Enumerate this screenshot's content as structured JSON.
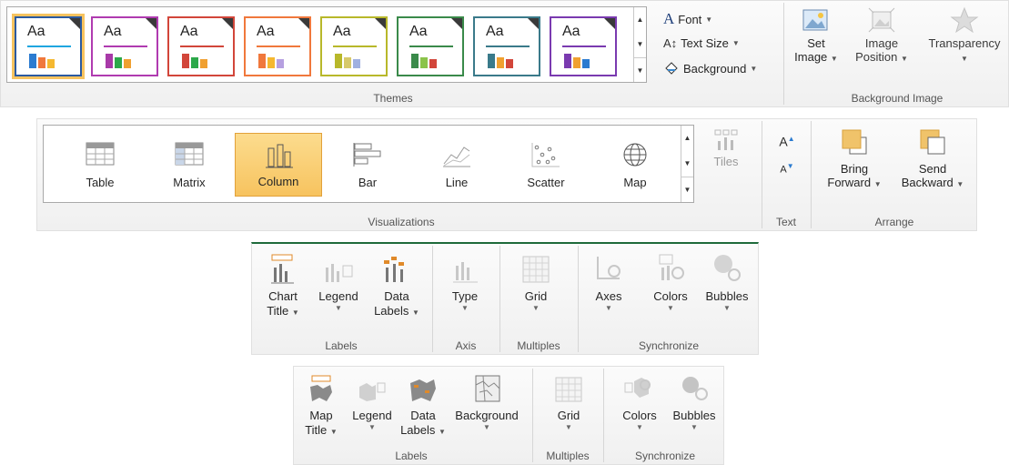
{
  "themes_ribbon": {
    "theme_label": "Aa",
    "themes": [
      {
        "accent": "#1fa6e0",
        "bars": [
          "#2b7bd0",
          "#f0783c",
          "#f5b830"
        ],
        "selected": true
      },
      {
        "accent": "#b03bb0",
        "bars": [
          "#a83aa8",
          "#2ca84a",
          "#f0a030"
        ],
        "selected": false
      },
      {
        "accent": "#d2463a",
        "bars": [
          "#d2463a",
          "#2ca84a",
          "#f0a030"
        ],
        "selected": false
      },
      {
        "accent": "#f0783c",
        "bars": [
          "#f0783c",
          "#f5b830",
          "#b6a0e0"
        ],
        "selected": false
      },
      {
        "accent": "#b8b82a",
        "bars": [
          "#b8b82a",
          "#d7c96a",
          "#a0b0e0"
        ],
        "selected": false
      },
      {
        "accent": "#3a8a4a",
        "bars": [
          "#3a8a4a",
          "#8bc34a",
          "#d2463a"
        ],
        "selected": false
      },
      {
        "accent": "#3a7a8a",
        "bars": [
          "#3a7a8a",
          "#f0a030",
          "#d2463a"
        ],
        "selected": false
      },
      {
        "accent": "#7a3ab0",
        "bars": [
          "#7a3ab0",
          "#f0a030",
          "#2b7bd0"
        ],
        "selected": false
      }
    ],
    "font_label": "Font",
    "text_size_label": "Text Size",
    "background_label": "Background",
    "themes_group_label": "Themes",
    "set_image_line1": "Set",
    "set_image_line2": "Image",
    "image_position_line1": "Image",
    "image_position_line2": "Position",
    "transparency_label": "Transparency",
    "background_image_group_label": "Background Image"
  },
  "viz_ribbon": {
    "items": [
      {
        "label": "Table",
        "icon": "table-icon"
      },
      {
        "label": "Matrix",
        "icon": "matrix-icon"
      },
      {
        "label": "Column",
        "icon": "column-chart-icon",
        "selected": true
      },
      {
        "label": "Bar",
        "icon": "bar-chart-icon"
      },
      {
        "label": "Line",
        "icon": "line-chart-icon"
      },
      {
        "label": "Scatter",
        "icon": "scatter-chart-icon"
      },
      {
        "label": "Map",
        "icon": "globe-icon"
      }
    ],
    "tiles_label": "Tiles",
    "visualizations_group_label": "Visualizations",
    "text_group_label": "Text",
    "bring_forward_line1": "Bring",
    "bring_forward_line2": "Forward",
    "send_backward_line1": "Send",
    "send_backward_line2": "Backward",
    "arrange_group_label": "Arrange",
    "increase_font_glyph": "A",
    "decrease_font_glyph": "A"
  },
  "chart_layout_ribbon": {
    "chart_title_line1": "Chart",
    "chart_title_line2": "Title",
    "legend_label": "Legend",
    "data_labels_line1": "Data",
    "data_labels_line2": "Labels",
    "labels_group_label": "Labels",
    "type_label": "Type",
    "axis_group_label": "Axis",
    "grid_label": "Grid",
    "multiples_group_label": "Multiples",
    "axes_label": "Axes",
    "colors_label": "Colors",
    "bubbles_label": "Bubbles",
    "synchronize_group_label": "Synchronize"
  },
  "map_layout_ribbon": {
    "map_title_line1": "Map",
    "map_title_line2": "Title",
    "legend_label": "Legend",
    "data_labels_line1": "Data",
    "data_labels_line2": "Labels",
    "background_label": "Background",
    "labels_group_label": "Labels",
    "grid_label": "Grid",
    "multiples_group_label": "Multiples",
    "colors_label": "Colors",
    "bubbles_label": "Bubbles",
    "synchronize_group_label": "Synchronize"
  },
  "colors": {
    "selected_fill": "#f7c35f",
    "selected_border": "#e2a13a",
    "dim_icon": "#c8c8c8"
  }
}
